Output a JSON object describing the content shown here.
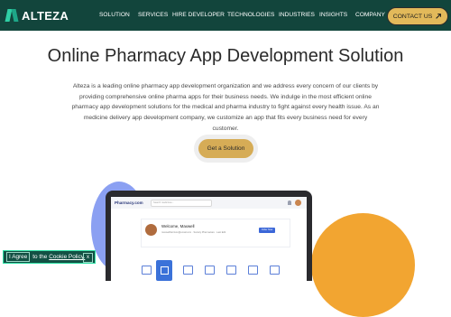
{
  "nav": {
    "brand": "ALTEZA",
    "items": [
      "SOLUTION",
      "SERVICES",
      "HIRE DEVELOPER",
      "TECHNOLOGIES",
      "INDUSTRIES",
      "INSIGHTS",
      "COMPANY"
    ],
    "contact_label": "CONTACT US",
    "contact_icon": "arrow-up-right-icon"
  },
  "hero": {
    "title": "Online Pharmacy App Development Solution",
    "description": "Alteza is a leading online pharmacy app development organization and we address every concern of our clients by providing comprehensive online pharma apps for their business needs. We indulge in the most efficient online pharmacy app development solutions for the medical and pharma industry to fight against every health issue. As an medicine delivery app development company, we customize an app that fits every business need for every customer.",
    "cta_label": "Get a Solution"
  },
  "mockup": {
    "brand": "Pharmacy.com",
    "search_placeholder": "Search medicines...",
    "welcome": "Welcome, Maxwell",
    "subtext": "maxwellharrison@email.com · Society Pharmacare · Last Edit",
    "button_label": "Order Now"
  },
  "cookie": {
    "agree_label": "I Agree",
    "text": "to the",
    "link_label": "Cookie Policy.",
    "close_label": "x"
  },
  "colors": {
    "nav_bg": "#12453c",
    "accent_gold": "#e2b95a",
    "cookie_bg": "#135144"
  }
}
